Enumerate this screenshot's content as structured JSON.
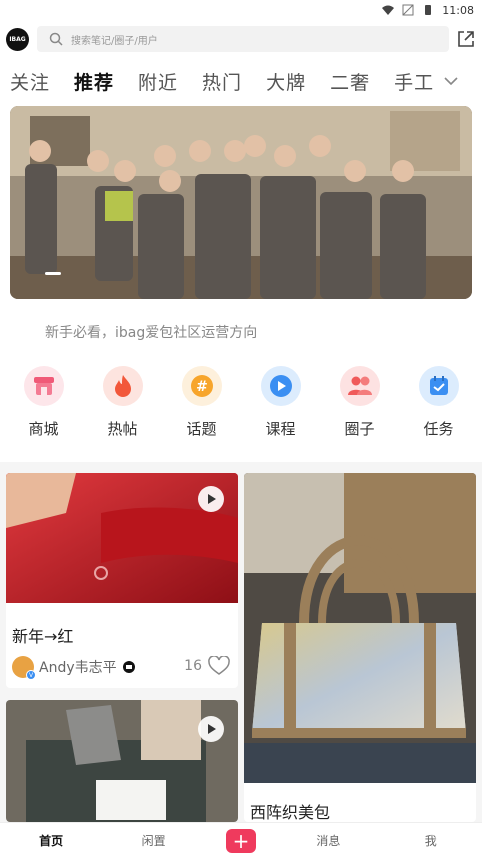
{
  "status_bar": {
    "time": "11:08",
    "icons": [
      "wifi-icon",
      "no-signal-icon",
      "battery-icon"
    ]
  },
  "header": {
    "logo_text": "IBAG",
    "search_placeholder": "搜索笔记/圈子/用户"
  },
  "tabs": [
    {
      "label": "关注",
      "active": false
    },
    {
      "label": "推荐",
      "active": true
    },
    {
      "label": "附近",
      "active": false
    },
    {
      "label": "热门",
      "active": false
    },
    {
      "label": "大牌",
      "active": false
    },
    {
      "label": "二奢",
      "active": false
    },
    {
      "label": "手工",
      "active": false
    }
  ],
  "notice": "新手必看，ibag爱包社区运营方向",
  "quick_links": [
    {
      "label": "商城",
      "icon": "shop-icon",
      "color": "#f05a78"
    },
    {
      "label": "热帖",
      "icon": "fire-icon",
      "color": "#f2573a"
    },
    {
      "label": "话题",
      "icon": "hashtag-icon",
      "color": "#f7a52b"
    },
    {
      "label": "课程",
      "icon": "play-course-icon",
      "color": "#3b8ff2"
    },
    {
      "label": "圈子",
      "icon": "group-icon",
      "color": "#f05a5a"
    },
    {
      "label": "任务",
      "icon": "task-icon",
      "color": "#3b8ff2"
    }
  ],
  "feed": {
    "card1": {
      "title": "新年→红",
      "author": "Andy韦志平",
      "likes": "16"
    },
    "card2": {
      "title": ""
    },
    "card3": {
      "title": "西阵织美包"
    }
  },
  "bottom_nav": [
    {
      "label": "首页",
      "active": true
    },
    {
      "label": "闲置",
      "active": false
    },
    {
      "label": "+",
      "plus": true
    },
    {
      "label": "消息",
      "active": false
    },
    {
      "label": "我",
      "active": false
    }
  ],
  "colors": {
    "accent": "#ef3a5d"
  }
}
